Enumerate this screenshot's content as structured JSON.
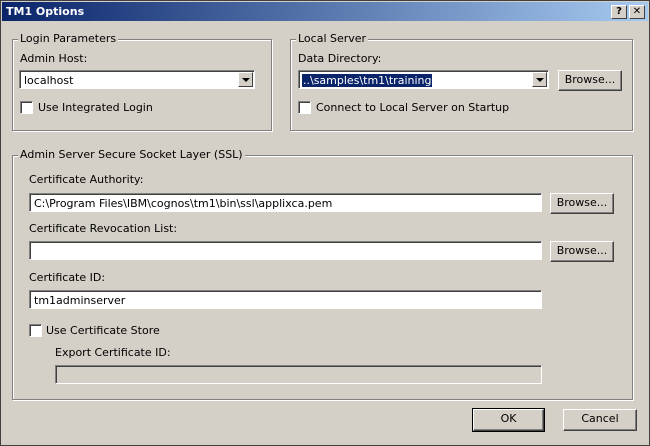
{
  "title": "TM1 Options",
  "titlebar": {
    "help": "?",
    "close": "✕"
  },
  "login": {
    "legend": "Login Parameters",
    "admin_host_label": "Admin Host:",
    "admin_host_value": "localhost",
    "integrated_login_label": "Use Integrated Login"
  },
  "local_server": {
    "legend": "Local Server",
    "data_dir_label": "Data Directory:",
    "data_dir_value": "..\\samples\\tm1\\training",
    "browse_label": "Browse...",
    "connect_label": "Connect to Local Server on Startup"
  },
  "ssl": {
    "legend": "Admin Server Secure Socket Layer (SSL)",
    "cert_authority_label": "Certificate Authority:",
    "cert_authority_value": "C:\\Program Files\\IBM\\cognos\\tm1\\bin\\ssl\\applixca.pem",
    "browse1_label": "Browse...",
    "revocation_label": "Certificate Revocation List:",
    "revocation_value": "",
    "browse2_label": "Browse...",
    "cert_id_label": "Certificate ID:",
    "cert_id_value": "tm1adminserver",
    "use_store_label": "Use Certificate Store",
    "export_id_label": "Export Certificate ID:",
    "export_id_value": ""
  },
  "footer": {
    "ok": "OK",
    "cancel": "Cancel"
  }
}
